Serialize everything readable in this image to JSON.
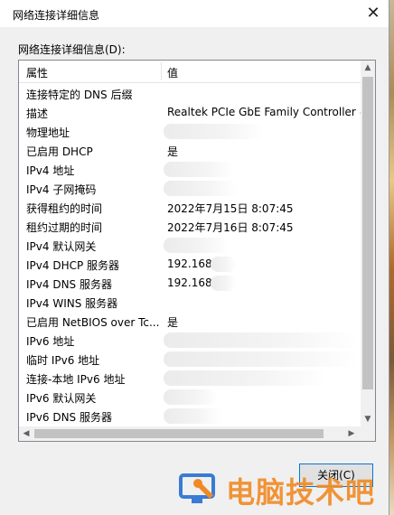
{
  "window": {
    "title": "网络连接详细信息",
    "close_glyph": "✕"
  },
  "group_label": "网络连接详细信息(D):",
  "table": {
    "columns": [
      "属性",
      "值"
    ],
    "rows": [
      {
        "key": "连接特定的 DNS 后缀",
        "value": ""
      },
      {
        "key": "描述",
        "value": "Realtek PCIe GbE Family Controller #"
      },
      {
        "key": "物理地址",
        "value": ""
      },
      {
        "key": "已启用 DHCP",
        "value": "是"
      },
      {
        "key": "IPv4 地址",
        "value": ""
      },
      {
        "key": "IPv4 子网掩码",
        "value": ""
      },
      {
        "key": "获得租约的时间",
        "value": "2022年7月15日 8:07:45"
      },
      {
        "key": "租约过期的时间",
        "value": "2022年7月16日 8:07:45"
      },
      {
        "key": "IPv4 默认网关",
        "value": ""
      },
      {
        "key": "IPv4 DHCP 服务器",
        "value": "192.168."
      },
      {
        "key": "IPv4 DNS 服务器",
        "value": "192.168."
      },
      {
        "key": "IPv4 WINS 服务器",
        "value": ""
      },
      {
        "key": "已启用 NetBIOS over Tc...",
        "value": "是"
      },
      {
        "key": "IPv6 地址",
        "value": ""
      },
      {
        "key": "临时 IPv6 地址",
        "value": ""
      },
      {
        "key": "连接-本地 IPv6 地址",
        "value": ""
      },
      {
        "key": "IPv6 默认网关",
        "value": ""
      },
      {
        "key": "IPv6 DNS 服务器",
        "value": ""
      }
    ]
  },
  "close_button": {
    "label": "关闭(C)"
  },
  "watermark": {
    "text": "电脑技术吧",
    "icon": "monitor-tool-icon",
    "color": "#f08a24"
  }
}
